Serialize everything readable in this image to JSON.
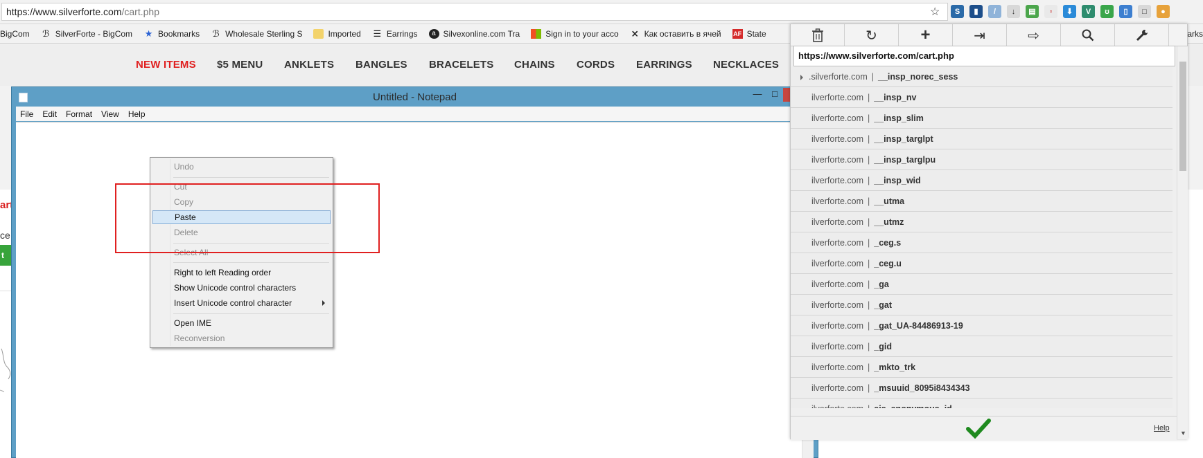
{
  "browser": {
    "url_host": "https://www.silverforte.com",
    "url_path": "/cart.php",
    "bookmarks": [
      {
        "label": "BigCom",
        "icon": "bigcommerce-icon"
      },
      {
        "label": "SilverForte - BigCom",
        "icon": "bigcommerce-icon"
      },
      {
        "label": "Bookmarks",
        "icon": "star-icon"
      },
      {
        "label": "Wholesale Sterling S",
        "icon": "bigcommerce-icon"
      },
      {
        "label": "Imported",
        "icon": "folder-icon"
      },
      {
        "label": "Earrings",
        "icon": "earrings-icon"
      },
      {
        "label": "Silvexonline.com Tra",
        "icon": "silvex-icon"
      },
      {
        "label": "Sign in to your acco",
        "icon": "microsoft-icon"
      },
      {
        "label": "Как оставить в ячей",
        "icon": "excel-icon"
      },
      {
        "label": "State",
        "icon": "af-icon"
      }
    ],
    "bookmarks_trailing": "arks"
  },
  "site": {
    "nav": [
      "NEW ITEMS",
      "$5 MENU",
      "ANKLETS",
      "BANGLES",
      "BRACELETS",
      "CHAINS",
      "CORDS",
      "EARRINGS",
      "NECKLACES"
    ],
    "left_red_text": "art",
    "left_text": "ce",
    "left_button": "t",
    "colors": {
      "accent_red": "#e01e1e",
      "green": "#37a43b"
    }
  },
  "notepad": {
    "title": "Untitled - Notepad",
    "min_glyph": "—",
    "max_glyph": "□",
    "close_glyph": "✕",
    "menus": [
      "File",
      "Edit",
      "Format",
      "View",
      "Help"
    ]
  },
  "context_menu": {
    "items": [
      {
        "label": "Undo",
        "enabled": false
      },
      {
        "label": "Cut",
        "enabled": false
      },
      {
        "label": "Copy",
        "enabled": false
      },
      {
        "label": "Paste",
        "enabled": true,
        "highlighted": true
      },
      {
        "label": "Delete",
        "enabled": false
      },
      {
        "label": "Select All",
        "enabled": false
      },
      {
        "label": "Right to left Reading order",
        "enabled": true
      },
      {
        "label": "Show Unicode control characters",
        "enabled": true
      },
      {
        "label": "Insert Unicode control character",
        "enabled": true,
        "submenu": true
      },
      {
        "label": "Open IME",
        "enabled": true
      },
      {
        "label": "Reconversion",
        "enabled": false
      }
    ]
  },
  "cookie_editor": {
    "tools": [
      "trash-icon",
      "refresh-icon",
      "plus-icon",
      "import-icon",
      "export-icon",
      "search-icon",
      "wrench-icon"
    ],
    "url": "https://www.silverforte.com/cart.php",
    "separator": "|",
    "rows": [
      {
        "domain": ".silverforte.com",
        "name": "__insp_norec_sess",
        "expandable": true
      },
      {
        "domain": "ilverforte.com",
        "name": "__insp_nv"
      },
      {
        "domain": "ilverforte.com",
        "name": "__insp_slim"
      },
      {
        "domain": "ilverforte.com",
        "name": "__insp_targlpt"
      },
      {
        "domain": "ilverforte.com",
        "name": "__insp_targlpu"
      },
      {
        "domain": "ilverforte.com",
        "name": "__insp_wid"
      },
      {
        "domain": "ilverforte.com",
        "name": "__utma"
      },
      {
        "domain": "ilverforte.com",
        "name": "__utmz"
      },
      {
        "domain": "ilverforte.com",
        "name": "_ceg.s"
      },
      {
        "domain": "ilverforte.com",
        "name": "_ceg.u"
      },
      {
        "domain": "ilverforte.com",
        "name": "_ga"
      },
      {
        "domain": "ilverforte.com",
        "name": "_gat"
      },
      {
        "domain": "ilverforte.com",
        "name": "_gat_UA-84486913-19"
      },
      {
        "domain": "ilverforte.com",
        "name": "_gid"
      },
      {
        "domain": "ilverforte.com",
        "name": "_mkto_trk"
      },
      {
        "domain": "ilverforte.com",
        "name": "_msuuid_8095i8434343"
      },
      {
        "domain": "ilverforte.com",
        "name": "ajs_anonymous_id"
      }
    ],
    "help_label": "Help",
    "colors": {
      "check": "#1f8a1f"
    }
  }
}
